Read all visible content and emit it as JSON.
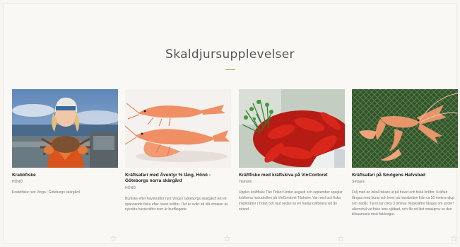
{
  "section": {
    "heading": "Skaldjursupplevelser"
  },
  "cards": [
    {
      "title": "Krabbfiske",
      "location": "HÖNÖ",
      "description": "Krabbfiske runt Vinga i Göteborgs skärgård",
      "image": "woman-holding-crab-on-boat"
    },
    {
      "title": "Kräftsafari med Äventyr % tång, Hönö - Göteborgs norra skärgård",
      "location": "HÖNÖ",
      "description": "Burfiske efter havskräftor runt Vinga i Göteborgs skärgård! Ett ett spännande fiske efter havet kräftor. Det är svårt att slå smaken av nykokta havskräftor som är burfångade.",
      "image": "two-crayfish-on-white"
    },
    {
      "title": "Kräftfiske med kräftskiva på VinContoret",
      "location": "Tilaholm",
      "description": "Upplev kräftfiske Tån Tidan! Under augusti och september speglar kräftorna huvudrollen på VinContoret Tilaholm. Var med och fiska insjökräftor i Tidan och njut sedan av en härlig kräftskiva vid ån strand.",
      "image": "red-crayfish-with-dill"
    },
    {
      "title": "Kräftsafari på Smögens Hafvsbad",
      "location": "Smögen",
      "description": "Följ med en lokal fiskare ut på havet och fiska kräftor. Kräftan fångas med burar och lever på havsbotten från ca 50 meters djup och nedåt. Turen tar cirka 3 timmar. Maxkräftor fångas om under! allernstvil vid fiske lens själbad, och får ett litet smakprov av den tillvaarnana med fiskkorgar.",
      "image": "crayfish-on-green-net"
    }
  ],
  "icons": {
    "favorite": "star-outline-icon"
  },
  "colors": {
    "accent": "#8fb04a",
    "background": "#f9f8f5",
    "star": "#c9c9c9"
  }
}
